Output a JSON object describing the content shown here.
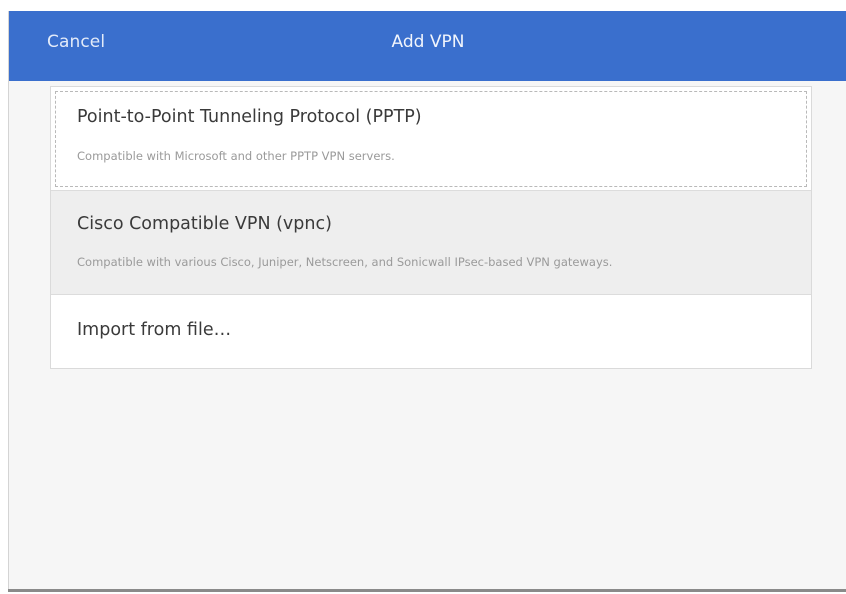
{
  "header": {
    "cancel_label": "Cancel",
    "title": "Add VPN",
    "background_color": "#3a6fcd"
  },
  "vpn_options": [
    {
      "title": "Point-to-Point Tunneling Protocol (PPTP)",
      "description": "Compatible with Microsoft and other PPTP VPN servers.",
      "state": "focused"
    },
    {
      "title": "Cisco Compatible VPN (vpnc)",
      "description": "Compatible with various Cisco, Juniper, Netscreen, and Sonicwall IPsec-based VPN gateways.",
      "state": "hover"
    },
    {
      "title": "Import from file…"
    }
  ]
}
